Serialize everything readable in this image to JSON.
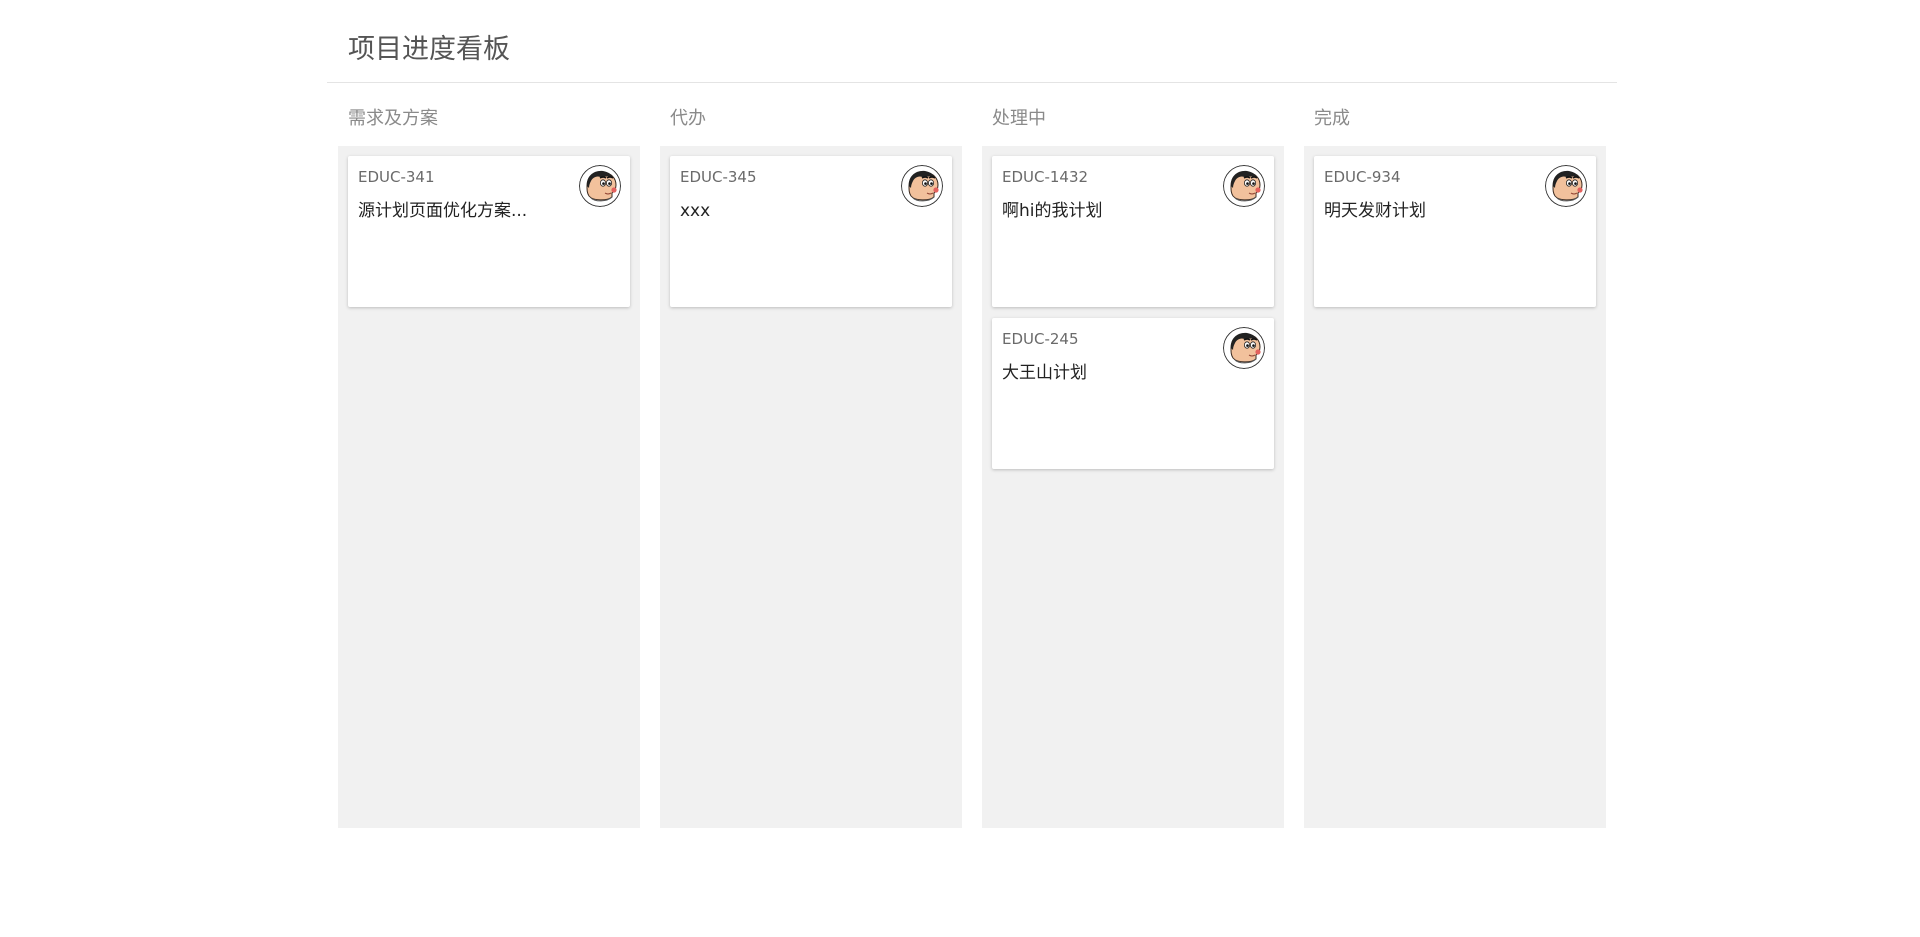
{
  "page": {
    "title": "项目进度看板"
  },
  "columns": [
    {
      "title": "需求及方案",
      "cards": [
        {
          "id": "EDUC-341",
          "title": "源计划页面优化方案..."
        }
      ]
    },
    {
      "title": "代办",
      "cards": [
        {
          "id": "EDUC-345",
          "title": "xxx"
        }
      ]
    },
    {
      "title": "处理中",
      "cards": [
        {
          "id": "EDUC-1432",
          "title": "啊hi的我计划"
        },
        {
          "id": "EDUC-245",
          "title": "大王山计划"
        }
      ]
    },
    {
      "title": "完成",
      "cards": [
        {
          "id": "EDUC-934",
          "title": "明天发财计划"
        }
      ]
    }
  ],
  "avatar_icon": "cartoon-boy-avatar",
  "colors": {
    "column_bg": "#f1f1f1",
    "title_text": "#555555",
    "column_title_text": "#8a8a8a"
  }
}
